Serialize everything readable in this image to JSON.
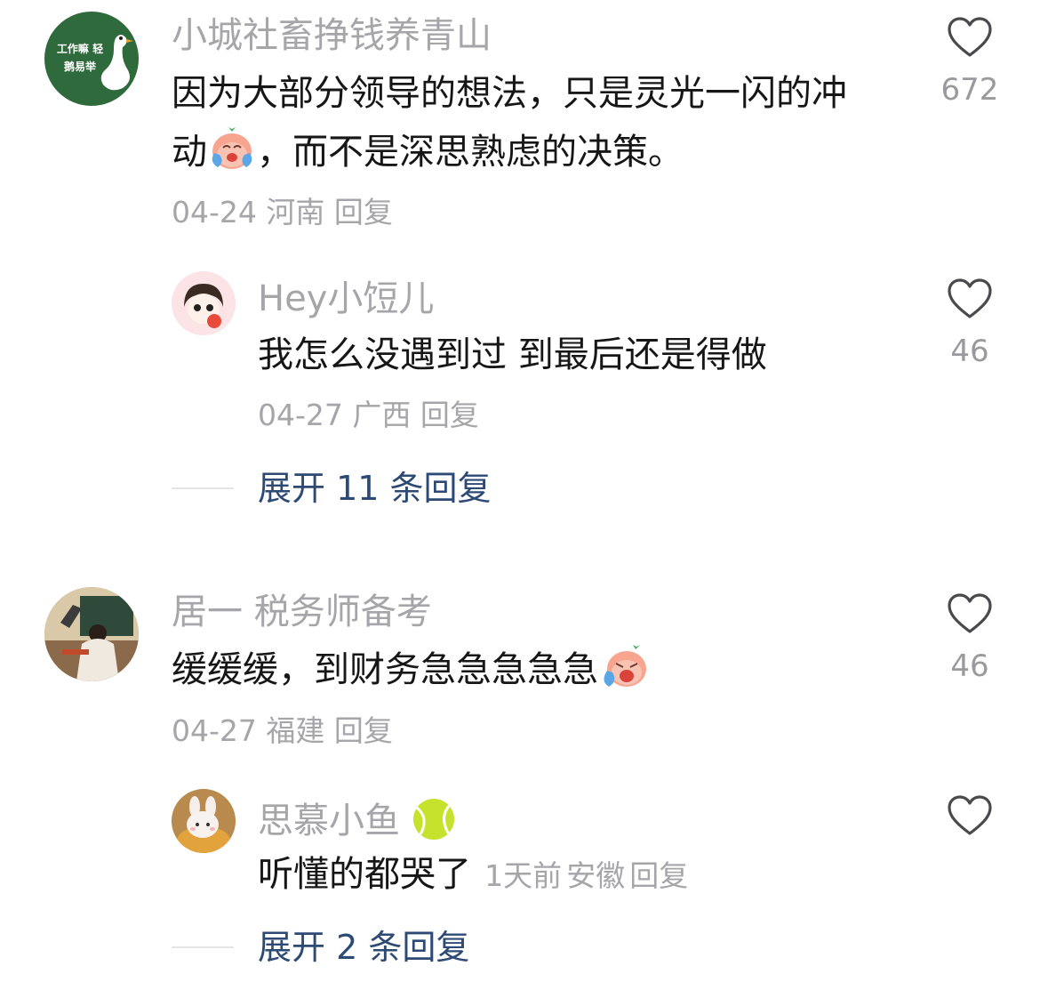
{
  "comments": [
    {
      "username": "小城社畜挣钱养青山",
      "avatar_text": "工作嘛 轻鹅易举",
      "text_line1": "因为大部分领导的想法，只是灵光一闪的冲",
      "text_line2_a": "动",
      "text_line2_b": "，而不是深思熟虑的决策。",
      "emoji": "crying-face-emoji",
      "date": "04-24",
      "region": "河南",
      "reply_label": "回复",
      "likes": "672",
      "replies": [
        {
          "username": "Hey小饾儿",
          "text": "我怎么没遇到过 到最后还是得做",
          "date": "04-27",
          "region": "广西",
          "reply_label": "回复",
          "likes": "46"
        }
      ],
      "expand_label": "展开 11 条回复"
    },
    {
      "username": "居一 税务师备考",
      "text": "缓缓缓，到财务急急急急急",
      "emoji": "crying-face-emoji",
      "date": "04-27",
      "region": "福建",
      "reply_label": "回复",
      "likes": "46",
      "replies": [
        {
          "username": "思慕小鱼",
          "username_icon": "tennis-ball-icon",
          "text": "听懂的都哭了",
          "time": "1天前",
          "region": "安徽",
          "reply_label": "回复"
        }
      ],
      "expand_label": "展开 2 条回复"
    }
  ],
  "colors": {
    "username": "#a6a6aa",
    "body": "#161616",
    "expand": "#2d4a75",
    "avatar1_bg": "#2e6a3b"
  }
}
